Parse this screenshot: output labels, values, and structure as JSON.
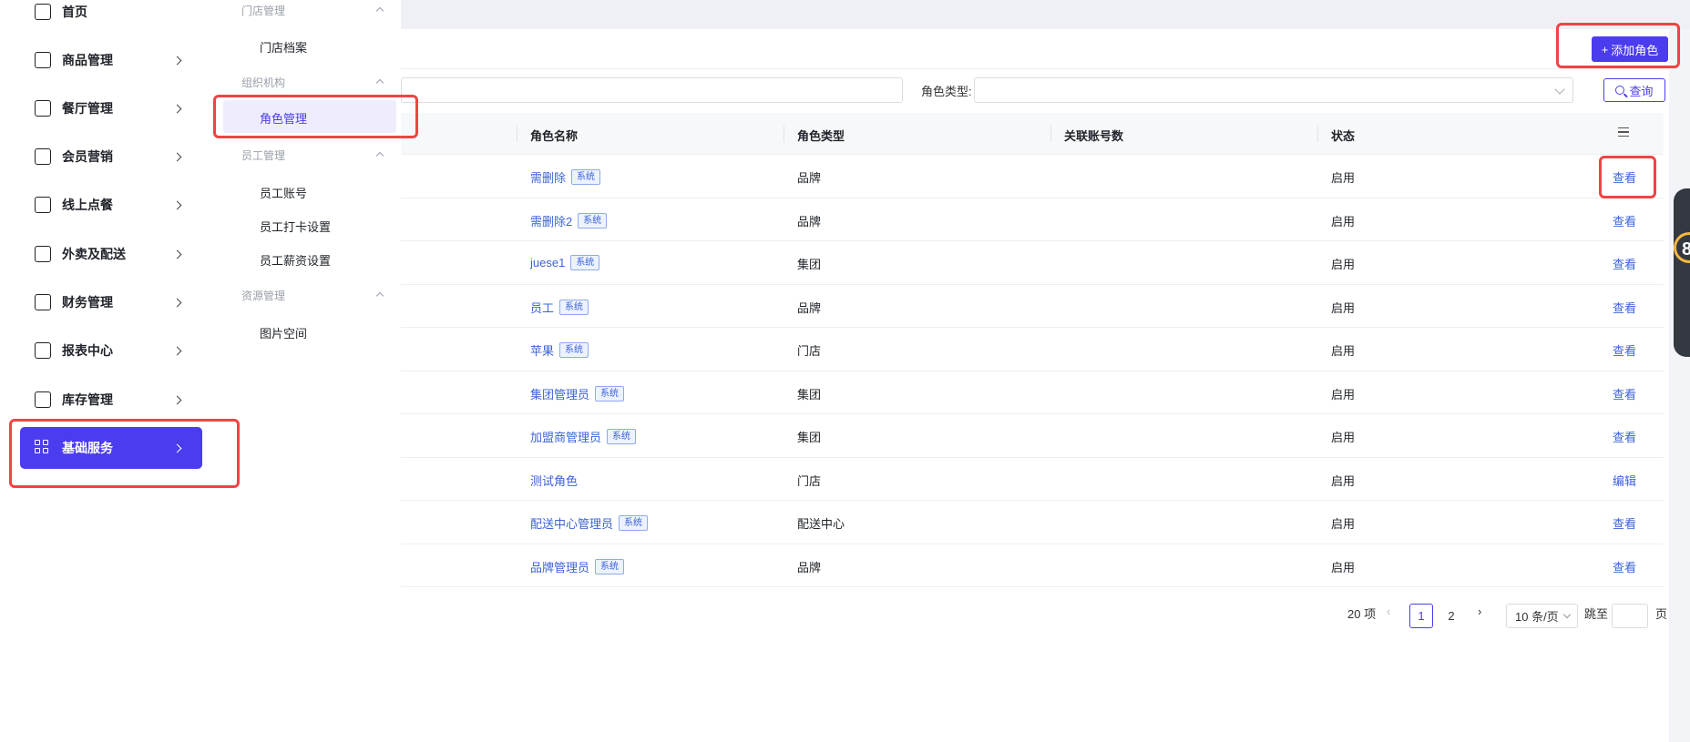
{
  "sidebar": {
    "items": [
      {
        "label": "首页",
        "icon": "home-icon"
      },
      {
        "label": "商品管理",
        "icon": "bag-icon"
      },
      {
        "label": "餐厅管理",
        "icon": "cloche-icon"
      },
      {
        "label": "会员营销",
        "icon": "phone-icon"
      },
      {
        "label": "线上点餐",
        "icon": "store-icon"
      },
      {
        "label": "外卖及配送",
        "icon": "truck-icon"
      },
      {
        "label": "财务管理",
        "icon": "moneybag-icon"
      },
      {
        "label": "报表中心",
        "icon": "report-icon"
      },
      {
        "label": "库存管理",
        "icon": "inventory-icon"
      },
      {
        "label": "基础服务",
        "icon": "grid-icon",
        "active": true
      }
    ]
  },
  "submenu": {
    "group_store": "门店管理",
    "store_archive": "门店档案",
    "group_org": "组织机构",
    "role_management": "角色管理",
    "group_staff": "员工管理",
    "staff_account": "员工账号",
    "staff_clock": "员工打卡设置",
    "staff_salary": "员工薪资设置",
    "group_resource": "资源管理",
    "image_space": "图片空间"
  },
  "header": {
    "add_role_label": "添加角色",
    "add_role_plus": "+"
  },
  "filters": {
    "role_type_label": "角色类型:",
    "query_label": "查询"
  },
  "table": {
    "columns": [
      "角色名称",
      "角色类型",
      "关联账号数",
      "状态"
    ],
    "rows": [
      {
        "name": "需删除",
        "badge": "系统",
        "type": "品牌",
        "count": "",
        "status": "启用",
        "action": "查看"
      },
      {
        "name": "需删除2",
        "badge": "系统",
        "type": "品牌",
        "count": "",
        "status": "启用",
        "action": "查看"
      },
      {
        "name": "juese1",
        "badge": "系统",
        "type": "集团",
        "count": "",
        "status": "启用",
        "action": "查看"
      },
      {
        "name": "员工",
        "badge": "系统",
        "type": "品牌",
        "count": "",
        "status": "启用",
        "action": "查看"
      },
      {
        "name": "苹果",
        "badge": "系统",
        "type": "门店",
        "count": "",
        "status": "启用",
        "action": "查看"
      },
      {
        "name": "集团管理员",
        "badge": "系统",
        "type": "集团",
        "count": "",
        "status": "启用",
        "action": "查看"
      },
      {
        "name": "加盟商管理员",
        "badge": "系统",
        "type": "集团",
        "count": "",
        "status": "启用",
        "action": "查看"
      },
      {
        "name": "测试角色",
        "badge": "",
        "type": "门店",
        "count": "",
        "status": "启用",
        "action": "编辑"
      },
      {
        "name": "配送中心管理员",
        "badge": "系统",
        "type": "配送中心",
        "count": "",
        "status": "启用",
        "action": "查看"
      },
      {
        "name": "品牌管理员",
        "badge": "系统",
        "type": "品牌",
        "count": "",
        "status": "启用",
        "action": "查看"
      }
    ]
  },
  "pagination": {
    "total": "20 项",
    "pages": [
      "1",
      "2"
    ],
    "current": "1",
    "page_size": "10 条/页",
    "jump_label": "跳至",
    "page_suffix": "页"
  },
  "widget": {
    "number": "8"
  },
  "colors": {
    "accent": "#4b3cf0",
    "link": "#3c63d8",
    "highlight": "#ef4444"
  }
}
